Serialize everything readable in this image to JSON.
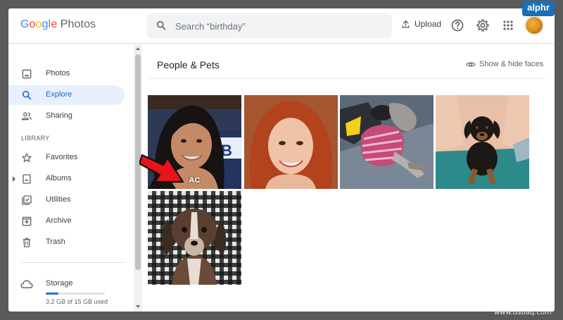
{
  "app": {
    "logo_word1": [
      {
        "ch": "G",
        "color": "#4285f4"
      },
      {
        "ch": "o",
        "color": "#ea4335"
      },
      {
        "ch": "o",
        "color": "#fbbc05"
      },
      {
        "ch": "g",
        "color": "#4285f4"
      },
      {
        "ch": "l",
        "color": "#34a853"
      },
      {
        "ch": "e",
        "color": "#ea4335"
      }
    ],
    "logo_word2": "Photos"
  },
  "header": {
    "search_placeholder": "Search “birthday”",
    "upload_label": "Upload"
  },
  "sidebar": {
    "items": [
      {
        "label": "Photos",
        "icon": "photo-icon"
      },
      {
        "label": "Explore",
        "icon": "search-icon",
        "active": true
      },
      {
        "label": "Sharing",
        "icon": "people-icon"
      }
    ],
    "library_label": "LIBRARY",
    "library_items": [
      {
        "label": "Favorites",
        "icon": "star-icon"
      },
      {
        "label": "Albums",
        "icon": "album-icon"
      },
      {
        "label": "Utilities",
        "icon": "checkbox-icon"
      },
      {
        "label": "Archive",
        "icon": "archive-icon"
      },
      {
        "label": "Trash",
        "icon": "trash-icon"
      }
    ],
    "storage": {
      "label": "Storage",
      "usage_text": "3.2 GB of 15 GB used",
      "usage_fraction": 0.21
    }
  },
  "main": {
    "title": "People & Pets",
    "show_hide_label": "Show & hide faces",
    "tiles": [
      {
        "name": "face-tile-ac",
        "label": "AC"
      },
      {
        "name": "face-tile-redhead",
        "label": ""
      },
      {
        "name": "pet-tile-dog-sweater",
        "label": ""
      },
      {
        "name": "pet-tile-puppy-lap",
        "label": ""
      },
      {
        "name": "pet-tile-dachshund",
        "label": ""
      }
    ]
  },
  "watermarks": {
    "alphr": "alphr",
    "dsuaq": "www.dsuaq.com"
  },
  "colors": {
    "accent": "#1a73e8",
    "active_bg": "#e8f0fe",
    "arrow_red": "#e8141a"
  }
}
